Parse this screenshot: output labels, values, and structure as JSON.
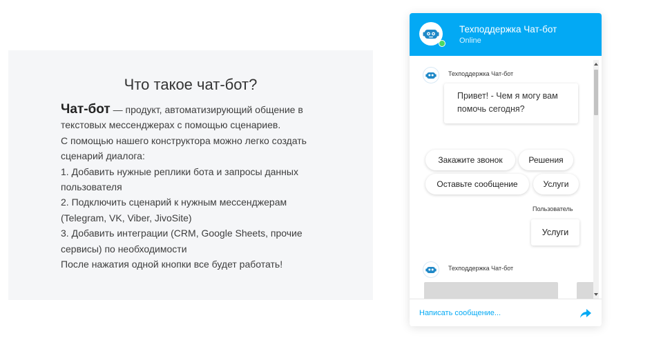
{
  "info": {
    "title": "Что такое чат-бот?",
    "term": "Чат-бот",
    "lead": " — продукт, автоматизирующий общение в",
    "lines": [
      "текстовых мессенджерах с помощью сценариев.",
      "С помощью нашего конструктора можно легко создать",
      "сценарий диалога:",
      "1. Добавить нужные реплики бота и запросы данных",
      "пользователя",
      "2. Подключить сценарий к нужным мессенджерам",
      "(Telegram, VK, Viber, JivoSite)",
      "3. Добавить интеграции (CRM, Google Sheets, прочие",
      "сервисы) по необходимости",
      "После нажатия одной кнопки все будет работать!"
    ]
  },
  "widget": {
    "title": "Техподдержка Чат-бот",
    "status": "Online",
    "accent": "#03a9f4",
    "messages": {
      "bot_name_1": "Техподдержка Чат-бот",
      "greeting_line1": "Привет! - Чем я могу вам",
      "greeting_line2": "помочь сегодня?",
      "user_name": "Пользователь",
      "user_reply": "Услуги",
      "bot_name_2": "Техподдержка Чат-бот"
    },
    "chips": [
      "Закажите звонок",
      "Решения",
      "Оставьте сообщение",
      "Услуги"
    ],
    "input_placeholder": "Написать сообщение...",
    "icons": {
      "avatar": "robot-icon",
      "send": "send-arrow-icon"
    }
  }
}
